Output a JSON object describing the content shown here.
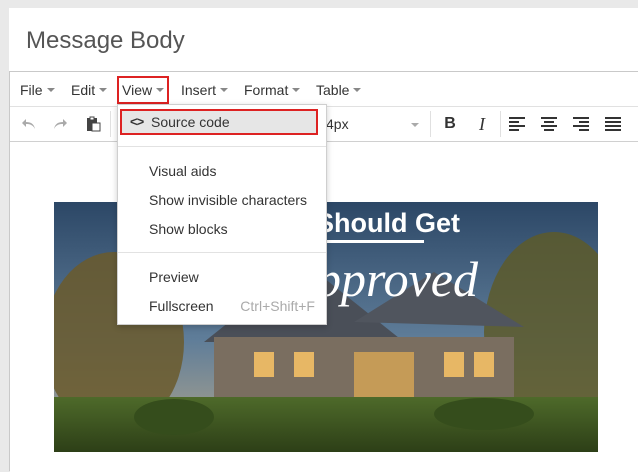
{
  "page": {
    "title": "Message Body"
  },
  "menubar": {
    "items": [
      {
        "label": "File"
      },
      {
        "label": "Edit"
      },
      {
        "label": "View"
      },
      {
        "label": "Insert"
      },
      {
        "label": "Format"
      },
      {
        "label": "Table"
      }
    ]
  },
  "toolbar": {
    "font_size": "4px",
    "bold": "B",
    "italic": "I"
  },
  "view_menu": {
    "source_code_icon": "<>",
    "source_code": "Source code",
    "visual_aids": "Visual aids",
    "show_invisible": "Show invisible characters",
    "show_blocks": "Show blocks",
    "preview": "Preview",
    "fullscreen": "Fullscreen",
    "fullscreen_shortcut": "Ctrl+Shift+F"
  },
  "image": {
    "line1": "Should Get",
    "line2": "pproved"
  },
  "colors": {
    "highlight": "#dd2222"
  }
}
